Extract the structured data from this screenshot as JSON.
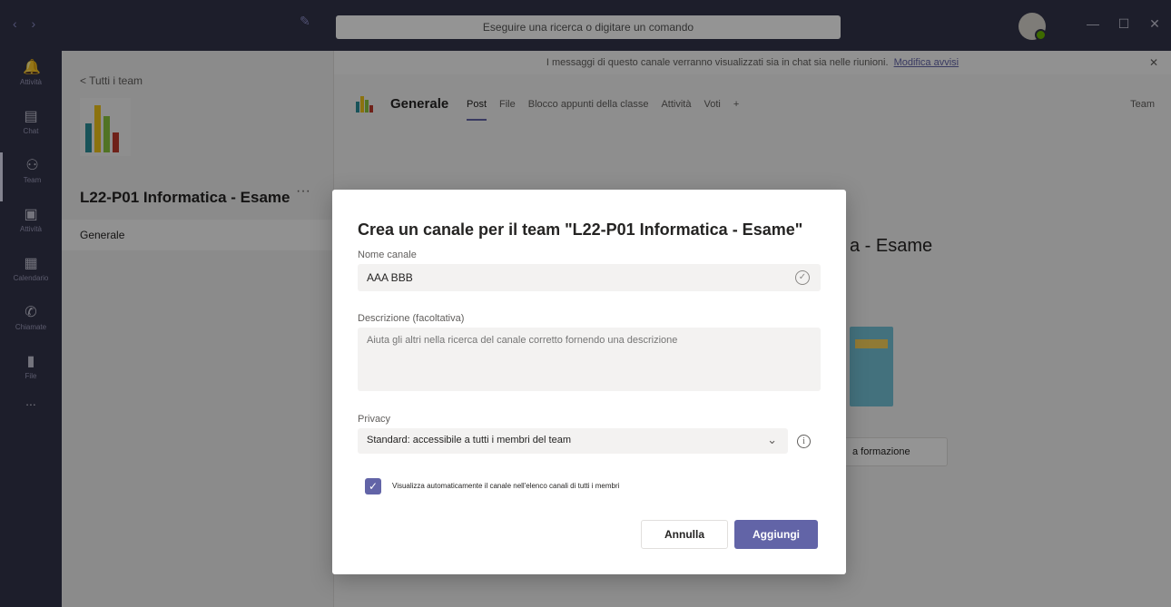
{
  "titlebar": {
    "search_placeholder": "Eseguire una ricerca o digitare un comando",
    "nav_icons": [
      "back-arrow-icon",
      "forward-arrow-icon"
    ],
    "window_controls": [
      "minimize-icon",
      "maximize-icon",
      "close-icon"
    ]
  },
  "rail": {
    "items": [
      {
        "icon": "bell-icon",
        "label": "Attività"
      },
      {
        "icon": "chat-icon",
        "label": "Chat"
      },
      {
        "icon": "teams-icon",
        "label": "Team"
      },
      {
        "icon": "assignments-icon",
        "label": "Attività"
      },
      {
        "icon": "calendar-icon",
        "label": "Calendario"
      },
      {
        "icon": "phone-icon",
        "label": "Chiamate"
      },
      {
        "icon": "files-icon",
        "label": "File"
      }
    ],
    "more": "..."
  },
  "team_pane": {
    "back_label": "< Tutti i team",
    "team_name": "L22-P01 Informatica - Esame",
    "more": "···",
    "channel": "Generale"
  },
  "main": {
    "banner_text": "I messaggi di questo canale verranno visualizzati sia in chat sia nelle riunioni.",
    "banner_link": "Modifica avvisi",
    "channel_title": "Generale",
    "tabs": [
      "Post",
      "File",
      "Blocco appunti della classe",
      "Attività",
      "Voti",
      "+"
    ],
    "right_label": "Team",
    "welcome_text": "a - Esame",
    "bg_button_label": "a formazione"
  },
  "dialog": {
    "title": "Crea un canale per il team \"L22-P01 Informatica - Esame\"",
    "name_label": "Nome canale",
    "name_value": "AAA BBB",
    "desc_label": "Descrizione (facoltativa)",
    "desc_placeholder": "Aiuta gli altri nella ricerca del canale corretto fornendo una descrizione",
    "privacy_label": "Privacy",
    "privacy_value": "Standard: accessibile a tutti i membri del team",
    "checkbox_label": "Visualizza automaticamente il canale nell'elenco canali di tutti i membri",
    "checkbox_checked": true,
    "cancel_label": "Annulla",
    "add_label": "Aggiungi",
    "accent_color": "#6264a7"
  }
}
